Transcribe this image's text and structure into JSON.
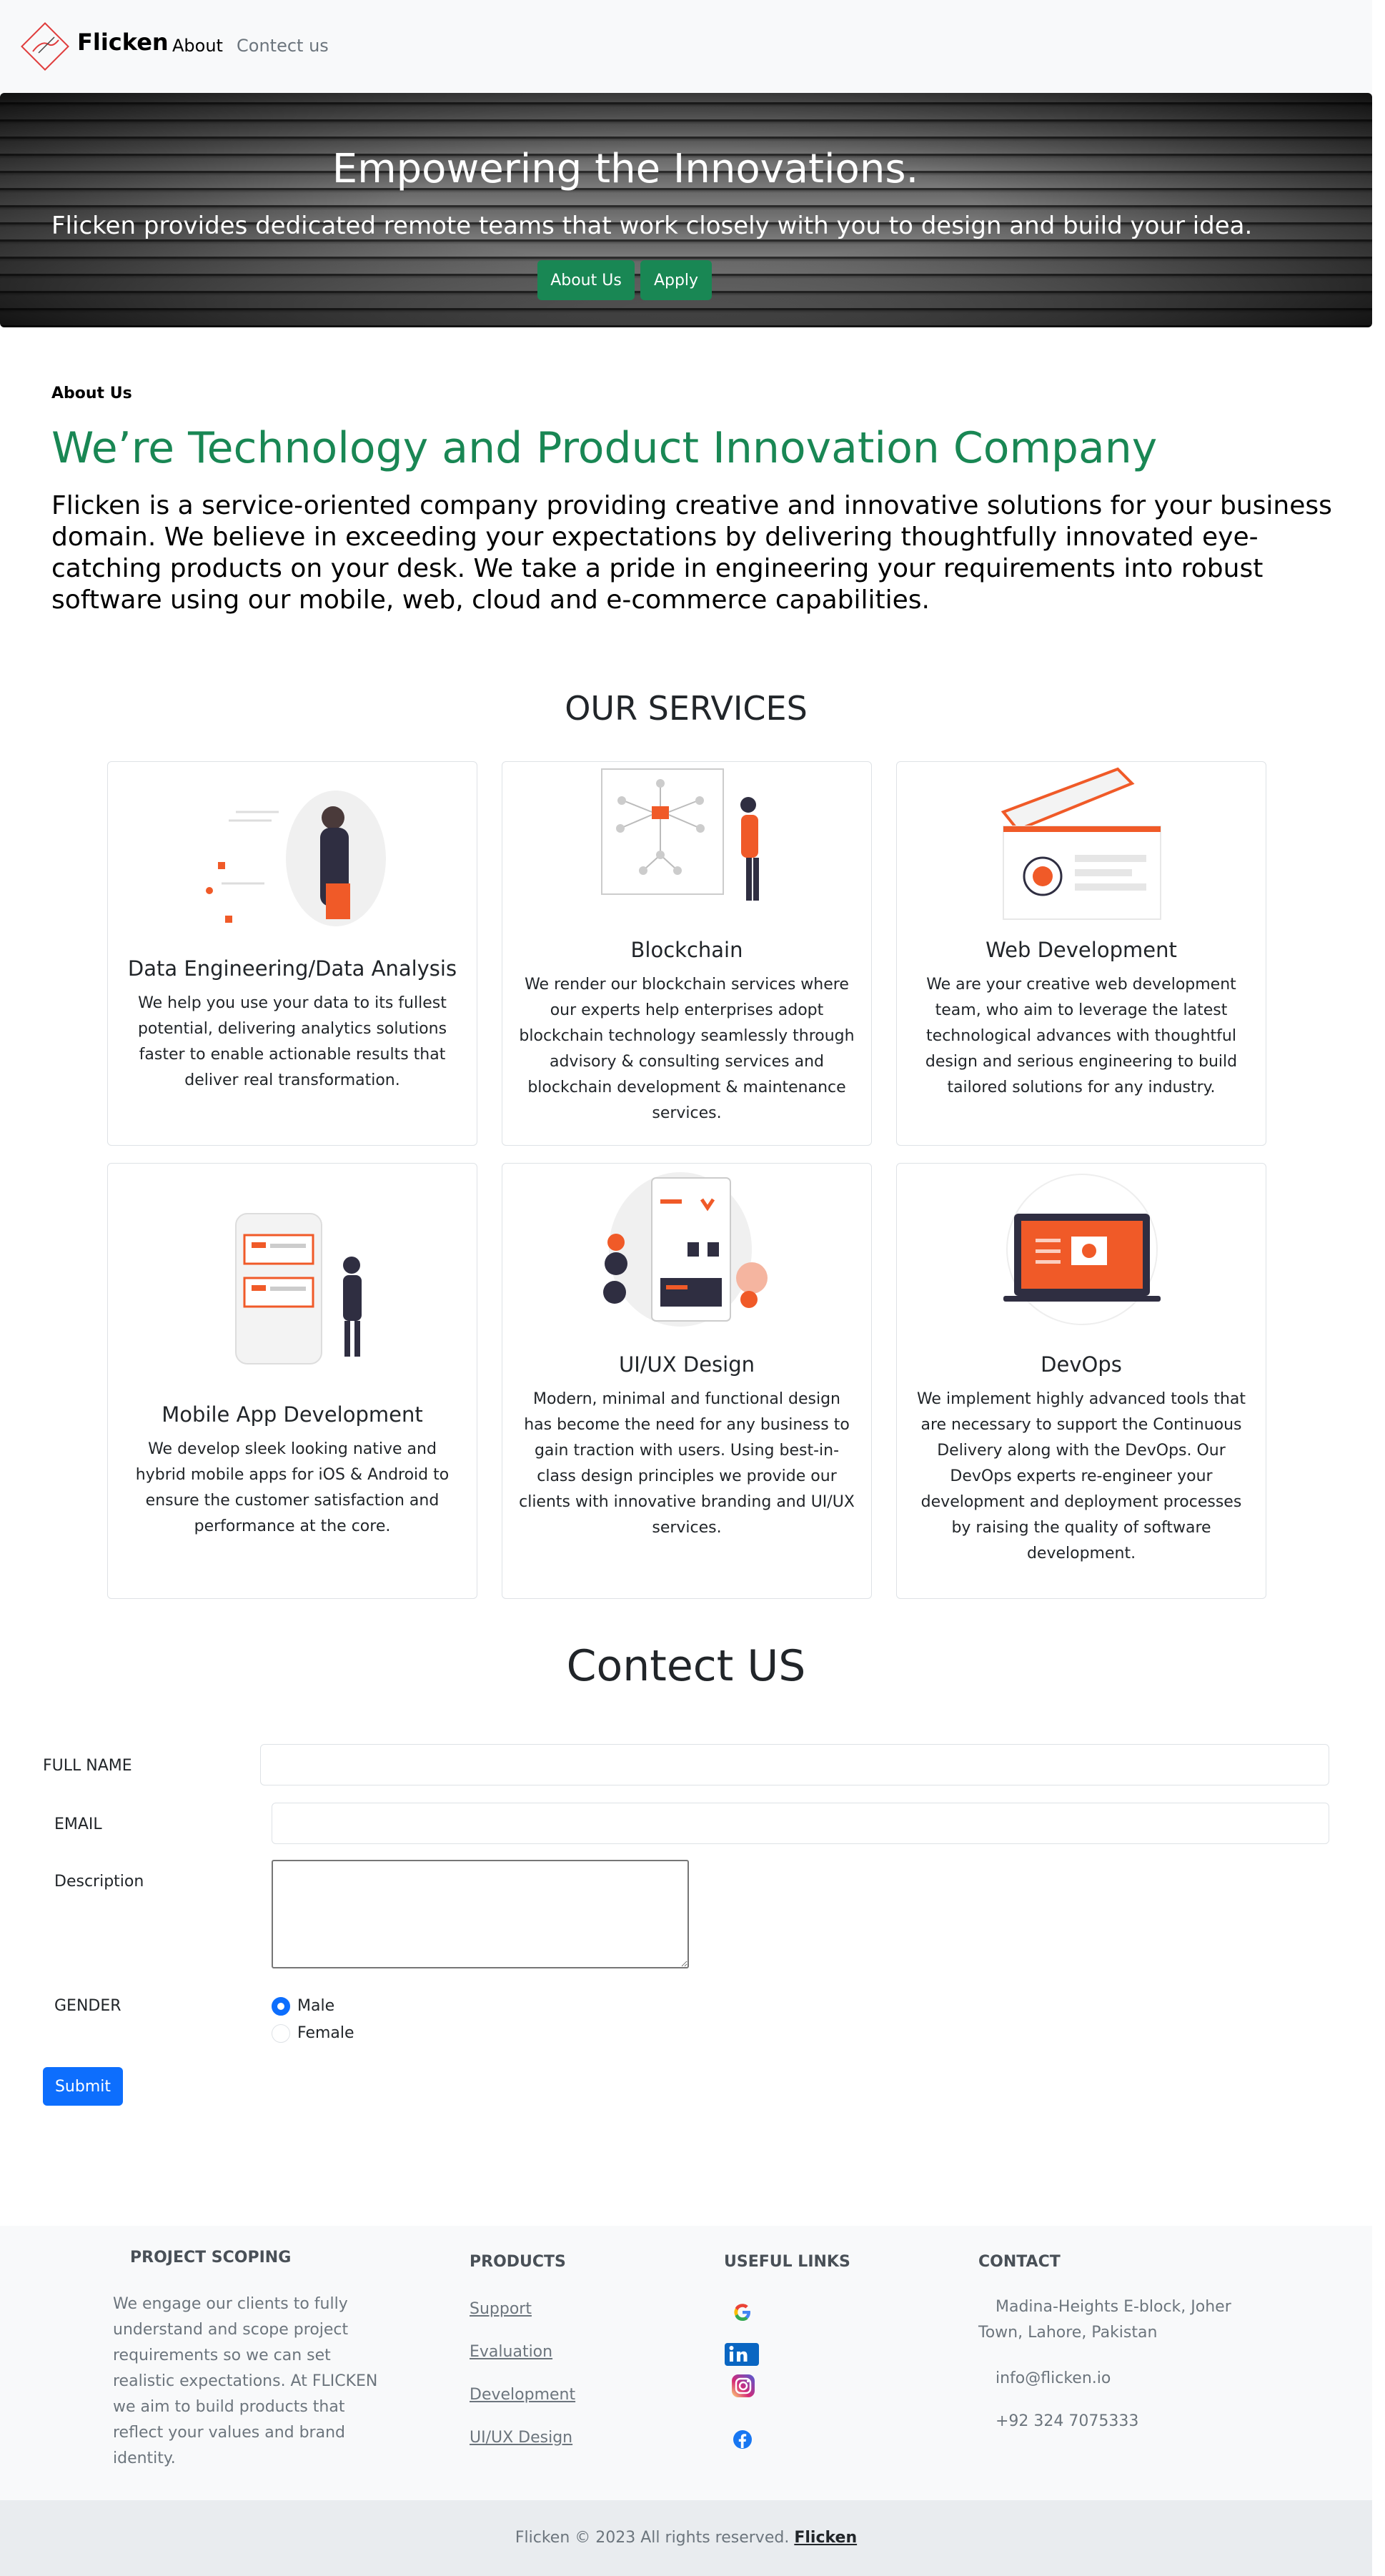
{
  "navbar": {
    "brand": "Flicken",
    "links": [
      "About",
      "Contect us"
    ]
  },
  "hero": {
    "title": "Empowering the Innovations.",
    "subtitle": "Flicken provides dedicated remote teams that work closely with you to design and build your idea.",
    "buttons": [
      "About Us",
      "Apply"
    ]
  },
  "about": {
    "label": "About Us",
    "heading": "We’re Technology and Product Innovation Company",
    "text": "Flicken is a service-oriented company providing creative and innovative solutions for your business domain. We believe in exceeding your expectations by delivering thoughtfully innovated eye-catching products on your desk. We take a pride in engineering your requirements into robust software using our mobile, web, cloud and e-commerce capabilities."
  },
  "services": {
    "title": "OUR SERVICES",
    "items": [
      {
        "title": "Data Engineering/Data Analysis",
        "text": "We help you use your data to its fullest potential, delivering analytics solutions faster to enable actionable results that deliver real transformation.",
        "icon": "data-analysis-illustration"
      },
      {
        "title": "Blockchain",
        "text": "We render our blockchain services where our experts help enterprises adopt blockchain technology seamlessly through advisory & consulting services and blockchain development & maintenance services.",
        "icon": "blockchain-illustration"
      },
      {
        "title": "Web Development",
        "text": "We are your creative web development team, who aim to leverage the latest technological advances with thoughtful design and serious engineering to build tailored solutions for any industry.",
        "icon": "web-development-illustration"
      },
      {
        "title": "Mobile App Development",
        "text": "We develop sleek looking native and hybrid mobile apps for iOS & Android to ensure the customer satisfaction and performance at the core.",
        "icon": "mobile-app-illustration"
      },
      {
        "title": "UI/UX Design",
        "text": "Modern, minimal and functional design has become the need for any business to gain traction with users. Using best-in-class design principles we provide our clients with innovative branding and UI/UX services.",
        "icon": "ui-ux-illustration"
      },
      {
        "title": "DevOps",
        "text": "We implement highly advanced tools that are necessary to support the Continuous Delivery along with the DevOps. Our DevOps experts re-engineer your development and deployment processes by raising the quality of software development.",
        "icon": "devops-illustration"
      }
    ]
  },
  "contact": {
    "title": "Contect US",
    "full_name_label": "FULL NAME",
    "full_name_value": "",
    "email_label": "EMAIL",
    "email_value": "",
    "description_label": "Description",
    "description_value": "",
    "gender_label": "GENDER",
    "gender_options": [
      "Male",
      "Female"
    ],
    "gender_selected": "Male",
    "submit_label": "Submit"
  },
  "footer": {
    "project_heading": "PROJECT SCOPING",
    "project_text": "We engage our clients to fully understand and scope project requirements so we can set realistic expectations. At FLICKEN we aim to build products that reflect your values and brand identity.",
    "products_heading": "PRODUCTS",
    "products": [
      "Support",
      "Evaluation",
      "Development",
      "UI/UX Design"
    ],
    "links_heading": "USEFUL LINKS",
    "social_icons": [
      "google-icon",
      "linkedin-icon",
      "instagram-icon",
      "facebook-icon"
    ],
    "contact_heading": "CONTACT",
    "address": "Madina-Heights E-block, Joher Town, Lahore, Pakistan",
    "email": "info@flicken.io",
    "phone": "+92 324 7075333",
    "copyright": "Flicken © 2023 All rights reserved.",
    "copyright_link": "Flicken"
  },
  "colors": {
    "brand_green": "#198754",
    "primary_blue": "#0d6efd",
    "illustration_accent": "#f05a28"
  }
}
